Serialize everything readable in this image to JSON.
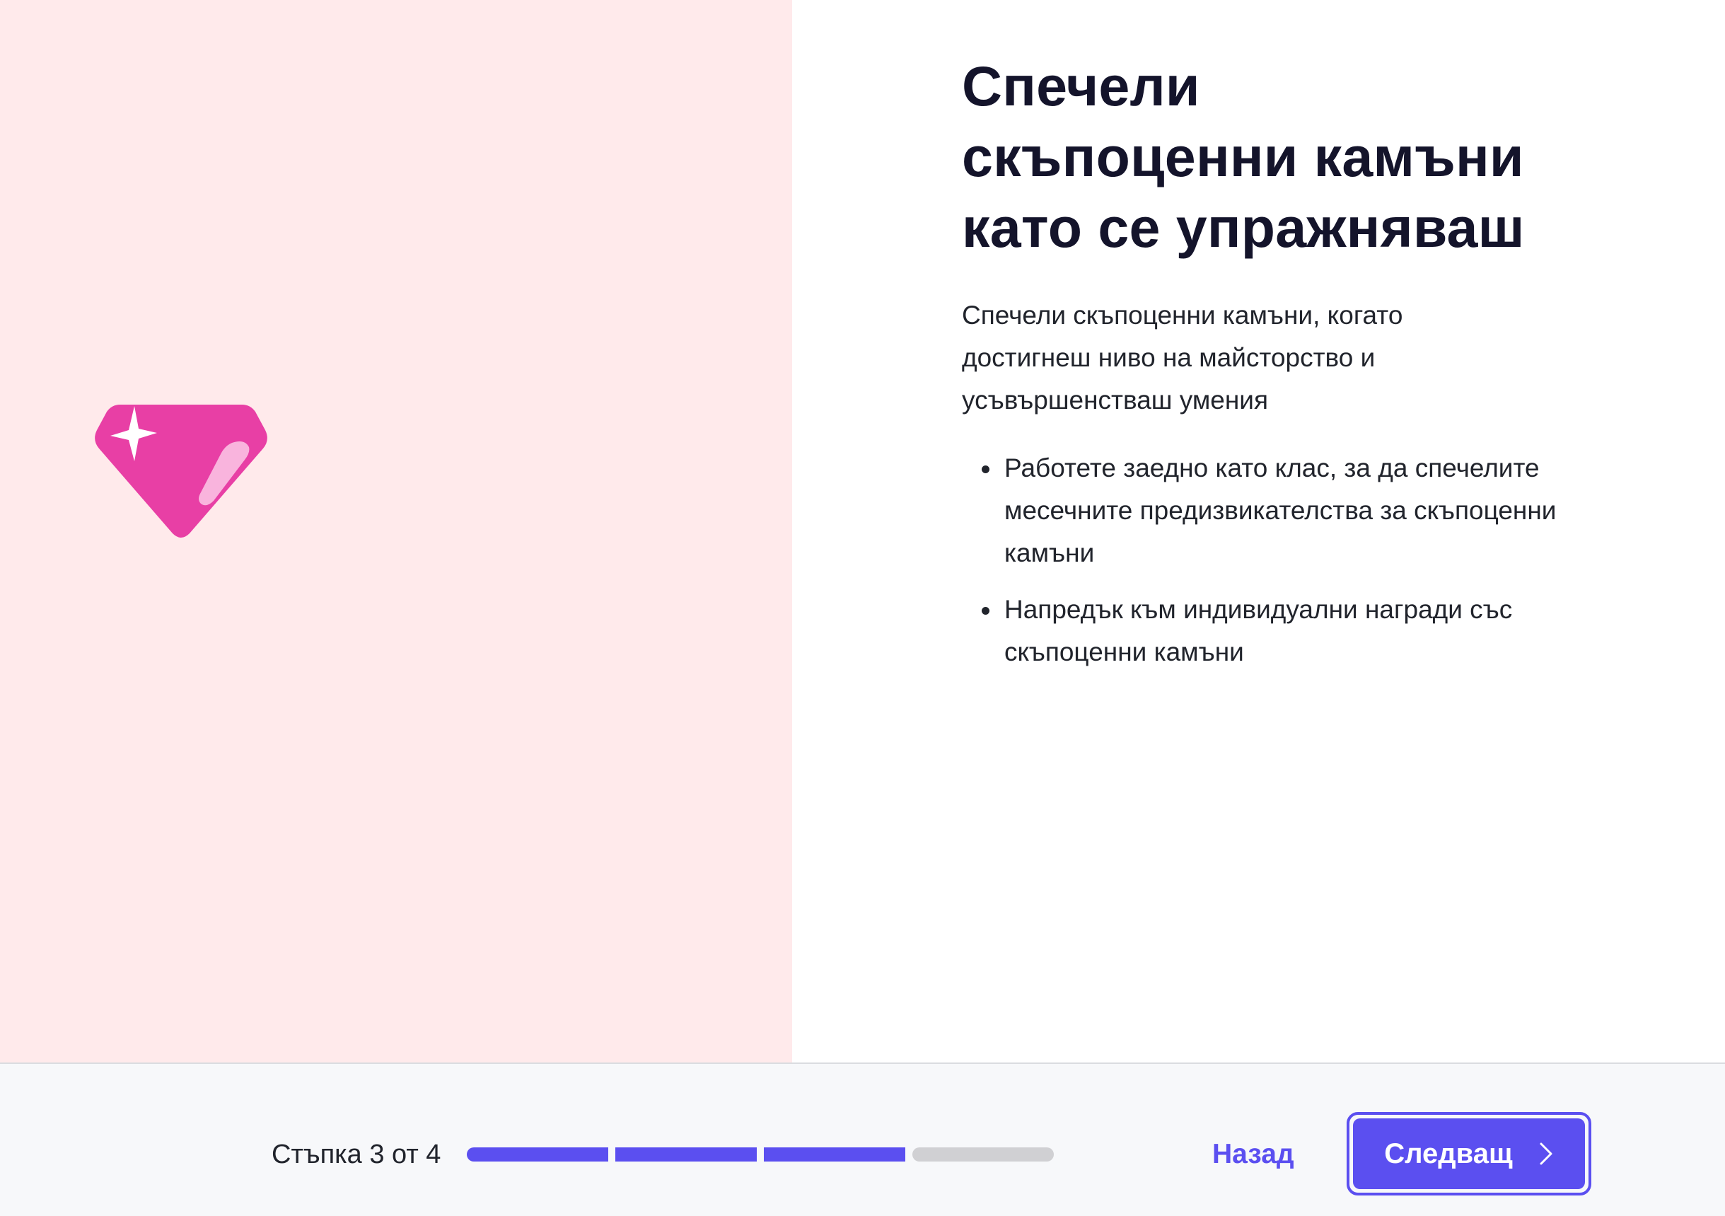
{
  "title": {
    "line1": "Спечели",
    "line2": "скъпоценни камъни",
    "line3": "като се упражняваш"
  },
  "description": "Спечели скъпоценни камъни, когато достигнеш ниво на майсторство и усъвършенстваш умения",
  "bullets": [
    "Работете заедно като клас, за да спечелите месечните предизвикателства за скъпоценни камъни",
    "Напредък към индивидуални награди със скъпоценни камъни"
  ],
  "illustration": {
    "icon": "gem-icon",
    "gem_color": "#e83fa5",
    "highlight_color": "#f9b4dd",
    "background_color": "#ffeaeb"
  },
  "footer": {
    "step_label": "Стъпка 3 от 4",
    "step_current": 3,
    "step_total": 4,
    "back_label": "Назад",
    "next_label": "Следващ",
    "next_icon": "chevron-right-icon",
    "accent_color": "#5b4ff0"
  }
}
